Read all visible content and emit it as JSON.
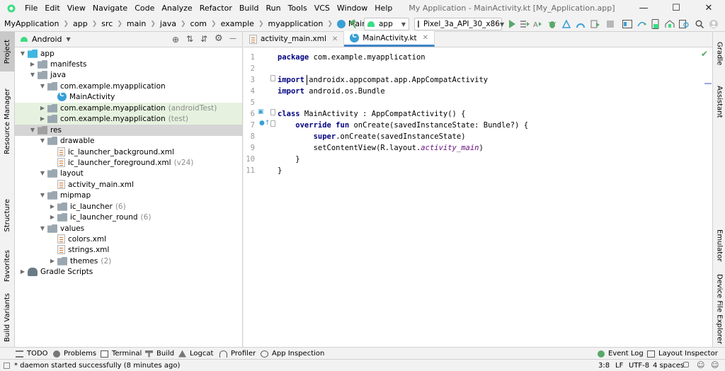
{
  "window": {
    "title": "My Application - MainActivity.kt [My_Application.app]",
    "menu": [
      "File",
      "Edit",
      "View",
      "Navigate",
      "Code",
      "Analyze",
      "Refactor",
      "Build",
      "Run",
      "Tools",
      "VCS",
      "Window",
      "Help"
    ]
  },
  "breadcrumb": [
    "MyApplication",
    "app",
    "src",
    "main",
    "java",
    "com",
    "example",
    "myapplication",
    "MainActivity"
  ],
  "toolbar": {
    "run_config": "app",
    "device": "Pixel_3a_API_30_x86"
  },
  "left_stripe": [
    "Project",
    "Resource Manager",
    "Structure",
    "Favorites",
    "Build Variants"
  ],
  "project": {
    "view_mode": "Android",
    "tree": [
      {
        "label": "app",
        "extra": ""
      },
      {
        "label": "manifests",
        "extra": ""
      },
      {
        "label": "java",
        "extra": ""
      },
      {
        "label": "com.example.myapplication",
        "extra": ""
      },
      {
        "label": "MainActivity",
        "extra": ""
      },
      {
        "label": "com.example.myapplication",
        "extra": "(androidTest)"
      },
      {
        "label": "com.example.myapplication",
        "extra": "(test)"
      },
      {
        "label": "res",
        "extra": ""
      },
      {
        "label": "drawable",
        "extra": ""
      },
      {
        "label": "ic_launcher_background.xml",
        "extra": ""
      },
      {
        "label": "ic_launcher_foreground.xml",
        "extra": "(v24)"
      },
      {
        "label": "layout",
        "extra": ""
      },
      {
        "label": "activity_main.xml",
        "extra": ""
      },
      {
        "label": "mipmap",
        "extra": ""
      },
      {
        "label": "ic_launcher",
        "extra": "(6)"
      },
      {
        "label": "ic_launcher_round",
        "extra": "(6)"
      },
      {
        "label": "values",
        "extra": ""
      },
      {
        "label": "colors.xml",
        "extra": ""
      },
      {
        "label": "strings.xml",
        "extra": ""
      },
      {
        "label": "themes",
        "extra": "(2)"
      },
      {
        "label": "Gradle Scripts",
        "extra": ""
      }
    ]
  },
  "editor": {
    "tabs": [
      "activity_main.xml",
      "MainActivity.kt"
    ],
    "line_numbers": [
      "1",
      "2",
      "3",
      "4",
      "5",
      "6",
      "7",
      "8",
      "9",
      "10",
      "11"
    ],
    "lines": {
      "l1_kw": "package",
      "l1_rest": " com.example.myapplication",
      "l3_kw": "import",
      "l3_rest": " androidx.appcompat.app.AppCompatActivity",
      "l4_kw": "import",
      "l4_rest": " android.os.Bundle",
      "l6_kw": "class",
      "l6_rest": " MainActivity : AppCompatActivity() {",
      "l7_kw": "    override fun",
      "l7_rest": " onCreate(savedInstanceState: Bundle?) {",
      "l8_kw": "        super",
      "l8_rest": ".onCreate(savedInstanceState)",
      "l9_pre": "        setContentView(R.layout.",
      "l9_it": "activity_main",
      "l9_post": ")",
      "l10": "    }",
      "l11": "}"
    }
  },
  "right_stripe": [
    "Gradle",
    "Assistant",
    "Emulator",
    "Device File Explorer"
  ],
  "bottom_tools": [
    "TODO",
    "Problems",
    "Terminal",
    "Build",
    "Logcat",
    "Profiler",
    "App Inspection",
    "Event Log",
    "Layout Inspector"
  ],
  "status": {
    "message": "* daemon started successfully (8 minutes ago)",
    "position": "3:8",
    "line_sep": "LF",
    "encoding": "UTF-8",
    "indent": "4 spaces"
  },
  "colors": {
    "accent": "#4083c9",
    "keyword": "#000080",
    "run_green": "#59a869"
  }
}
